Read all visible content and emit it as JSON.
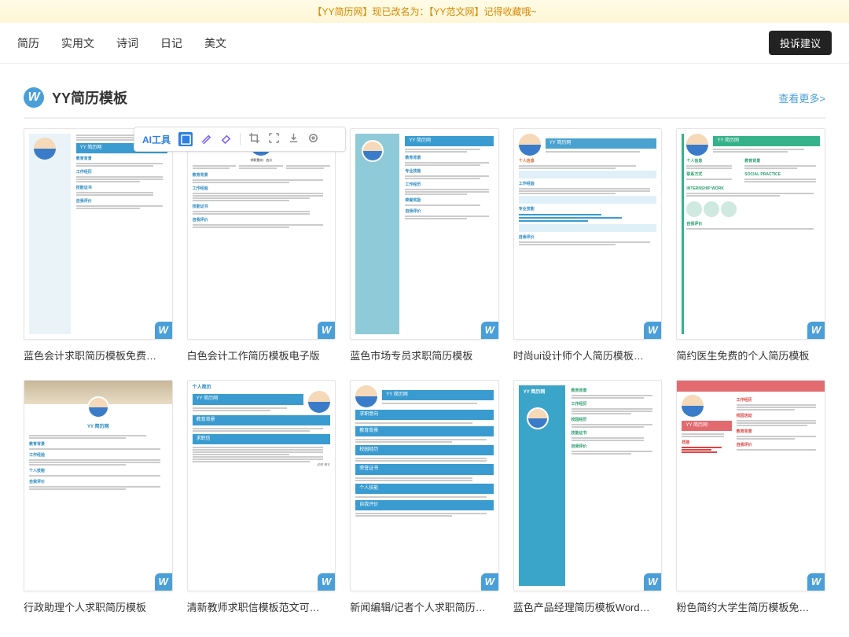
{
  "banner": {
    "text": "【YY简历网】现已改名为：【YY范文网】记得收藏哦~"
  },
  "nav": {
    "items": [
      {
        "label": "简历"
      },
      {
        "label": "实用文"
      },
      {
        "label": "诗词"
      },
      {
        "label": "日记"
      },
      {
        "label": "美文"
      }
    ],
    "feedback_label": "投诉建议"
  },
  "section": {
    "logo_letter": "W",
    "title": "YY简历模板",
    "more_label": "查看更多>"
  },
  "toolbar": {
    "ai_label": "AI工具",
    "icons": [
      "select",
      "pen",
      "eraser",
      "crop",
      "bounds",
      "download",
      "target"
    ]
  },
  "brand_text": "YY 简历网",
  "cards": [
    {
      "title": "蓝色会计求职简历模板免费…",
      "style": "blue-left",
      "badge": "W"
    },
    {
      "title": "白色会计工作简历模板电子版",
      "style": "white-center",
      "badge": "W"
    },
    {
      "title": "蓝色市场专员求职简历模板",
      "style": "teal-side",
      "badge": "W"
    },
    {
      "title": "时尚ui设计师个人简历模板…",
      "style": "ui-minimal",
      "badge": "W"
    },
    {
      "title": "简约医生免费的个人简历模板",
      "style": "green-doctor",
      "badge": "W"
    },
    {
      "title": "行政助理个人求职简历模板",
      "style": "photo-header",
      "badge": "W"
    },
    {
      "title": "清新教师求职信模板范文可…",
      "style": "teacher-blue",
      "badge": "W"
    },
    {
      "title": "新闻编辑/记者个人求职简历…",
      "style": "news-blue",
      "badge": "W"
    },
    {
      "title": "蓝色产品经理简历模板Word…",
      "style": "pm-blue",
      "badge": "W"
    },
    {
      "title": "粉色简约大学生简历模板免…",
      "style": "pink",
      "badge": "W"
    }
  ]
}
